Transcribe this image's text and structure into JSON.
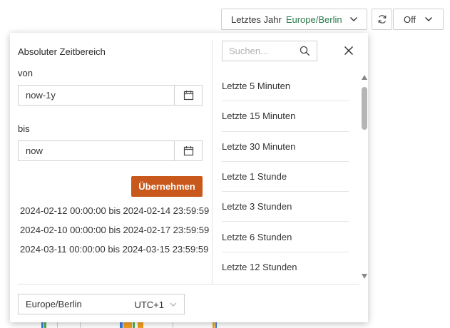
{
  "toolbar": {
    "range_label": "Letztes Jahr",
    "range_timezone": "Europe/Berlin",
    "refresh_label": "Off"
  },
  "panel": {
    "absolute_title": "Absoluter Zeitbereich",
    "from_label": "von",
    "from_value": "now-1y",
    "to_label": "bis",
    "to_value": "now",
    "apply_label": "Übernehmen",
    "recent_ranges": [
      "2024-02-12 00:00:00 bis 2024-02-14 23:59:59",
      "2024-02-10 00:00:00 bis 2024-02-17 23:59:59",
      "2024-03-11 00:00:00 bis 2024-03-15 23:59:59"
    ],
    "search_placeholder": "Suchen...",
    "quick_ranges": [
      "Letzte 5 Minuten",
      "Letzte 15 Minuten",
      "Letzte 30 Minuten",
      "Letzte 1 Stunde",
      "Letzte 3 Stunden",
      "Letzte 6 Stunden",
      "Letzte 12 Stunden"
    ],
    "timezone_name": "Europe/Berlin",
    "timezone_offset": "UTC+1"
  },
  "colors": {
    "accent_button": "#c8581b",
    "timezone_text": "#2a7a49",
    "border": "#cfcfcf"
  },
  "icons": {
    "refresh": "refresh-icon",
    "calendar": "calendar-icon",
    "search": "search-icon",
    "close": "close-icon",
    "chevron": "chevron-down-icon"
  }
}
